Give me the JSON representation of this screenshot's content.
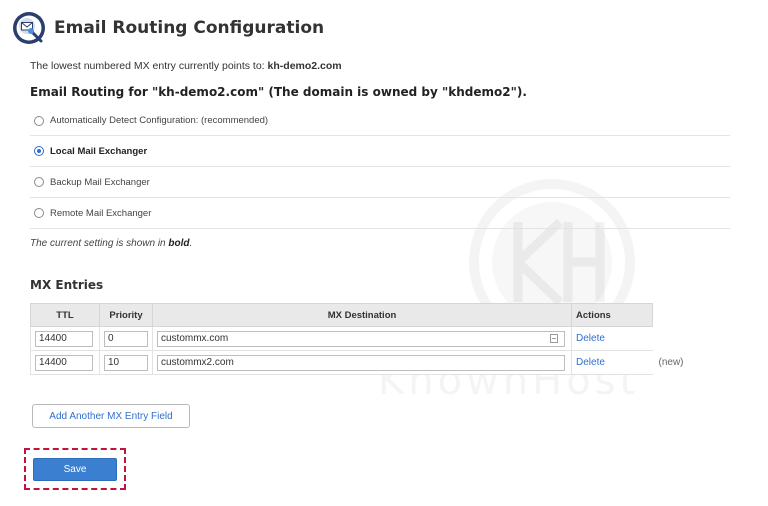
{
  "header": {
    "title": "Email Routing Configuration",
    "icon": "email-routing-icon"
  },
  "mx_pointer": {
    "label": "The lowest numbered MX entry currently points to:",
    "value": "kh-demo2.com"
  },
  "routing_heading": "Email Routing for \"kh-demo2.com\" (The domain is owned by \"khdemo2\").",
  "options": [
    {
      "label": "Automatically Detect Configuration: (recommended)",
      "checked": false
    },
    {
      "label": "Local Mail Exchanger",
      "checked": true
    },
    {
      "label": "Backup Mail Exchanger",
      "checked": false
    },
    {
      "label": "Remote Mail Exchanger",
      "checked": false
    }
  ],
  "note": {
    "prefix": "The current setting is shown in",
    "bold": "bold",
    "suffix": "."
  },
  "mx_entries": {
    "heading": "MX Entries",
    "columns": [
      "TTL",
      "Priority",
      "MX Destination",
      "Actions"
    ],
    "rows": [
      {
        "ttl": "14400",
        "priority": "0",
        "destination": "custommx.com",
        "action": "Delete",
        "extra": ""
      },
      {
        "ttl": "14400",
        "priority": "10",
        "destination": "custommx2.com",
        "action": "Delete",
        "extra": "(new)"
      }
    ]
  },
  "buttons": {
    "add_label": "Add Another MX Entry Field",
    "save_label": "Save"
  },
  "watermark": "KnownHost",
  "colors": {
    "link": "#2f6fcf",
    "primary_button": "#3a7fd0",
    "highlight": "#c0143c"
  }
}
